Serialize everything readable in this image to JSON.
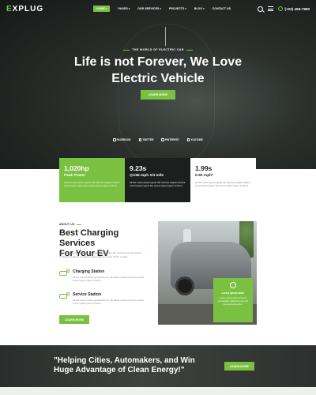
{
  "brand": {
    "logo_prefix": "E",
    "logo_rest": "XPLUG",
    "accent": "#7ac142",
    "dark": "#1d1f1e"
  },
  "nav": {
    "items": [
      {
        "label": "HOME",
        "dropdown": true
      },
      {
        "label": "PAGES",
        "dropdown": true
      },
      {
        "label": "OUR SERVICES",
        "dropdown": true
      },
      {
        "label": "PROJECTS",
        "dropdown": true
      },
      {
        "label": "BLOG",
        "dropdown": true
      },
      {
        "label": "CONTACT US",
        "dropdown": false
      }
    ],
    "phone": "(+03) 456-7890"
  },
  "hero": {
    "eyebrow": "THE WORLD OF ELECTRIC CAR",
    "title_line1": "Life is not Forever, We Love",
    "title_line2": "Electric Vehicle",
    "button": "LEARN MORE",
    "socials": [
      "FACEBOOK",
      "TWITTER",
      "PINTEREST",
      "YOUTUBE"
    ]
  },
  "stats": [
    {
      "value": "1,020hp",
      "label": "Peak Power",
      "desc": "All the Lorem Ipsum gene the Internet repeat content Lorem Ipsum gene the Lorem Ipsum gene content."
    },
    {
      "value": "9.23s",
      "label": "@155 mph 1/4 mile",
      "desc": "All the Lorem Ipsum gene the Internet repeat content Lorem Ipsum gene the Lorem Ipsum gene content."
    },
    {
      "value": "1.99s",
      "label": "0-60 mph*",
      "desc": "All the Lorem Ipsum gene the Internet repeat content Lorem Ipsum gene the Lorem Ipsum gene content."
    }
  ],
  "about": {
    "eyebrow": "ABOUT US",
    "title_line1": "Best Charging Services",
    "title_line2": "For Your EV",
    "desc": "Lorem ipsum dolor sit amet consectetur adipiscing elit, sed do eiusmod tempor incididunt ut labore et dolore magna aliqua ut enim minim veniam.",
    "features": [
      {
        "title": "Charging Station",
        "desc": "All the Lorem Ipsum generators on the Alteer Internet tend to repeat Lorem Ipsum gene content."
      },
      {
        "title": "Service Station",
        "desc": "All the Lorem Ipsum generators on the Alteer Internet tend to repeat Lorem Ipsum gene content."
      }
    ],
    "button": "LEARN MORE",
    "card": {
      "title": "Lorem ipsum dolor",
      "desc": "Lorem ipsum dolor sit amet, consectetur adipiscing elit, sed do eiusmod tempor."
    }
  },
  "cta": {
    "title_line1": "\"Helping Cities, Automakers, and Win",
    "title_line2": "Huge Advantage of Clean Energy!\"",
    "button": "LEARN MORE"
  }
}
